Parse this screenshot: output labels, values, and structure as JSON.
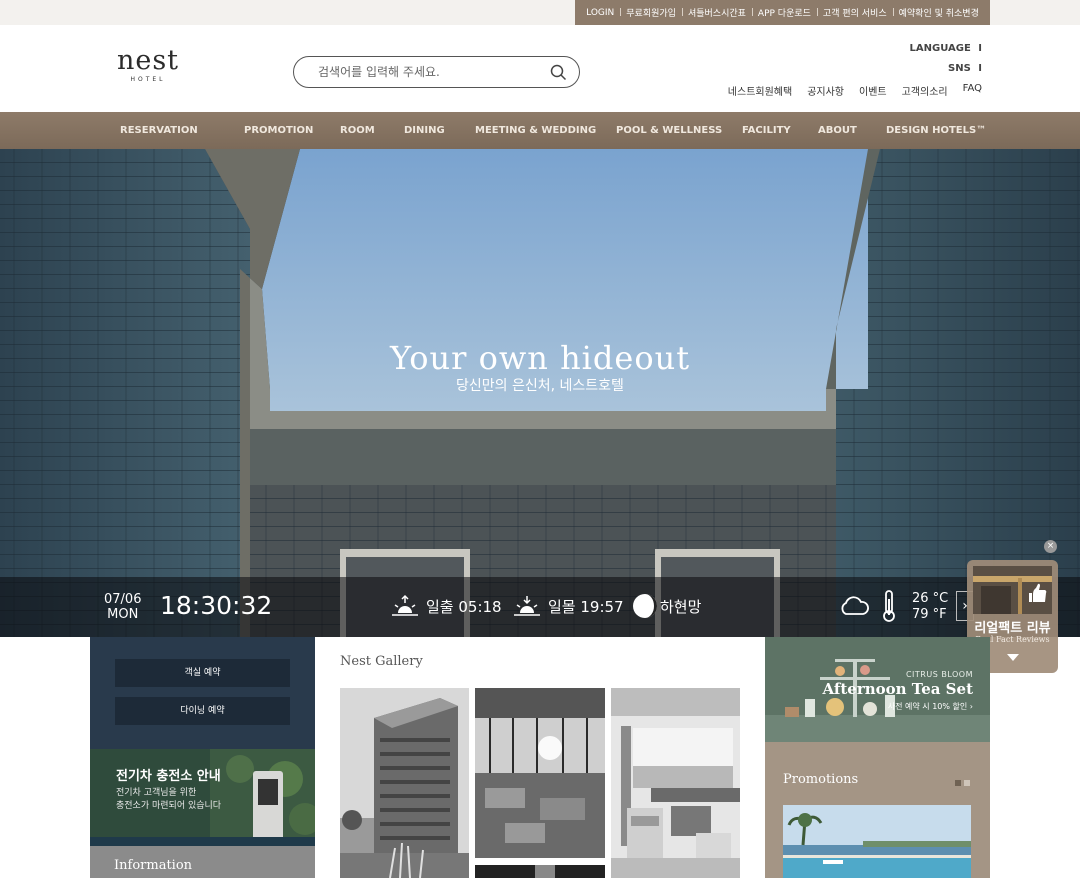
{
  "topbar": {
    "links": [
      "LOGIN",
      "무료회원가입",
      "셔틀버스시간표",
      "APP 다운로드",
      "고객 편의 서비스",
      "예약확인 및 취소변경"
    ]
  },
  "header": {
    "logo_word": "nest",
    "logo_sub": "HOTEL",
    "search_placeholder": "검색어를 입력해 주세요.",
    "util_links": [
      "LANGUAGE",
      "SNS"
    ],
    "sub_links": [
      "네스트회원혜택",
      "공지사항",
      "이벤트",
      "고객의소리",
      "FAQ"
    ]
  },
  "nav": {
    "items": [
      "RESERVATION",
      "PROMOTION",
      "ROOM",
      "DINING",
      "MEETING & WEDDING",
      "POOL & WELLNESS",
      "FACILITY",
      "ABOUT",
      "DESIGN HOTELS™"
    ]
  },
  "hero": {
    "title": "Your own hideout",
    "subtitle": "당신만의 은신처, 네스트호텔"
  },
  "infobar": {
    "date": "07/06",
    "weekday": "MON",
    "time": "18:30:32",
    "sunrise": "일출 05:18",
    "sunset": "일몰 19:57",
    "moon": "하현망",
    "temp_c": "26 °C",
    "temp_f": "79 °F",
    "icons": [
      "sunrise-icon",
      "sunset-icon",
      "moon-icon",
      "cloud-icon",
      "thermometer-icon",
      "chevron-right-icon"
    ]
  },
  "review_widget": {
    "title": "리얼팩트 리뷰",
    "subtitle": "Real Fact Reviews"
  },
  "left": {
    "room_btn": "객실 예약",
    "dining_btn": "다이닝 예약",
    "ev_title": "전기차 충전소 안내",
    "ev_desc": "전기차 고객님을 위한\n충전소가 마련되어 있습니다",
    "info_title": "Information"
  },
  "gallery": {
    "title": "Nest Gallery"
  },
  "right": {
    "tea_small": "CITRUS BLOOM",
    "tea_title": "Afternoon Tea Set",
    "tea_desc": "사전 예약 시 10% 할인",
    "promo_title": "Promotions"
  },
  "colors": {
    "nav_bg": "#8e7b69",
    "topbar_links_bg": "#8d7b6a",
    "left_top_bg": "#293a4c",
    "promo_bg": "#a49585"
  }
}
